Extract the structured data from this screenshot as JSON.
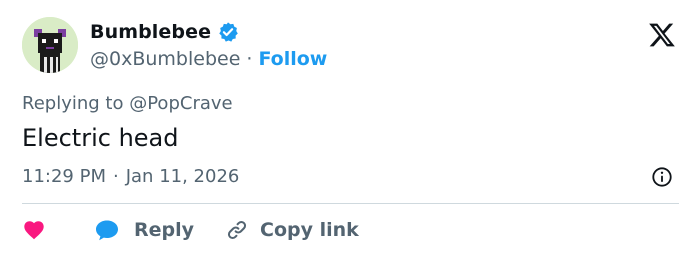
{
  "author": {
    "display_name": "Bumblebee",
    "handle": "@0xBumblebee",
    "separator": "·",
    "follow_label": "Follow",
    "verified": true
  },
  "reply_context": {
    "prefix": "Replying to",
    "mention": "@PopCrave"
  },
  "tweet": {
    "text": "Electric head",
    "time": "11:29 PM",
    "separator": "·",
    "date": "Jan 11, 2026"
  },
  "actions": {
    "reply_label": "Reply",
    "copy_link_label": "Copy link"
  },
  "icons": {
    "like": "heart-icon",
    "reply": "speech-bubble-icon",
    "copy": "link-icon",
    "info": "info-icon",
    "brand": "x-logo-icon",
    "verified": "verified-badge-icon"
  },
  "colors": {
    "accent": "#1d9bf0",
    "like": "#f91880",
    "secondary_text": "#536471",
    "primary_text": "#0f1419",
    "divider": "#cfd9de"
  }
}
